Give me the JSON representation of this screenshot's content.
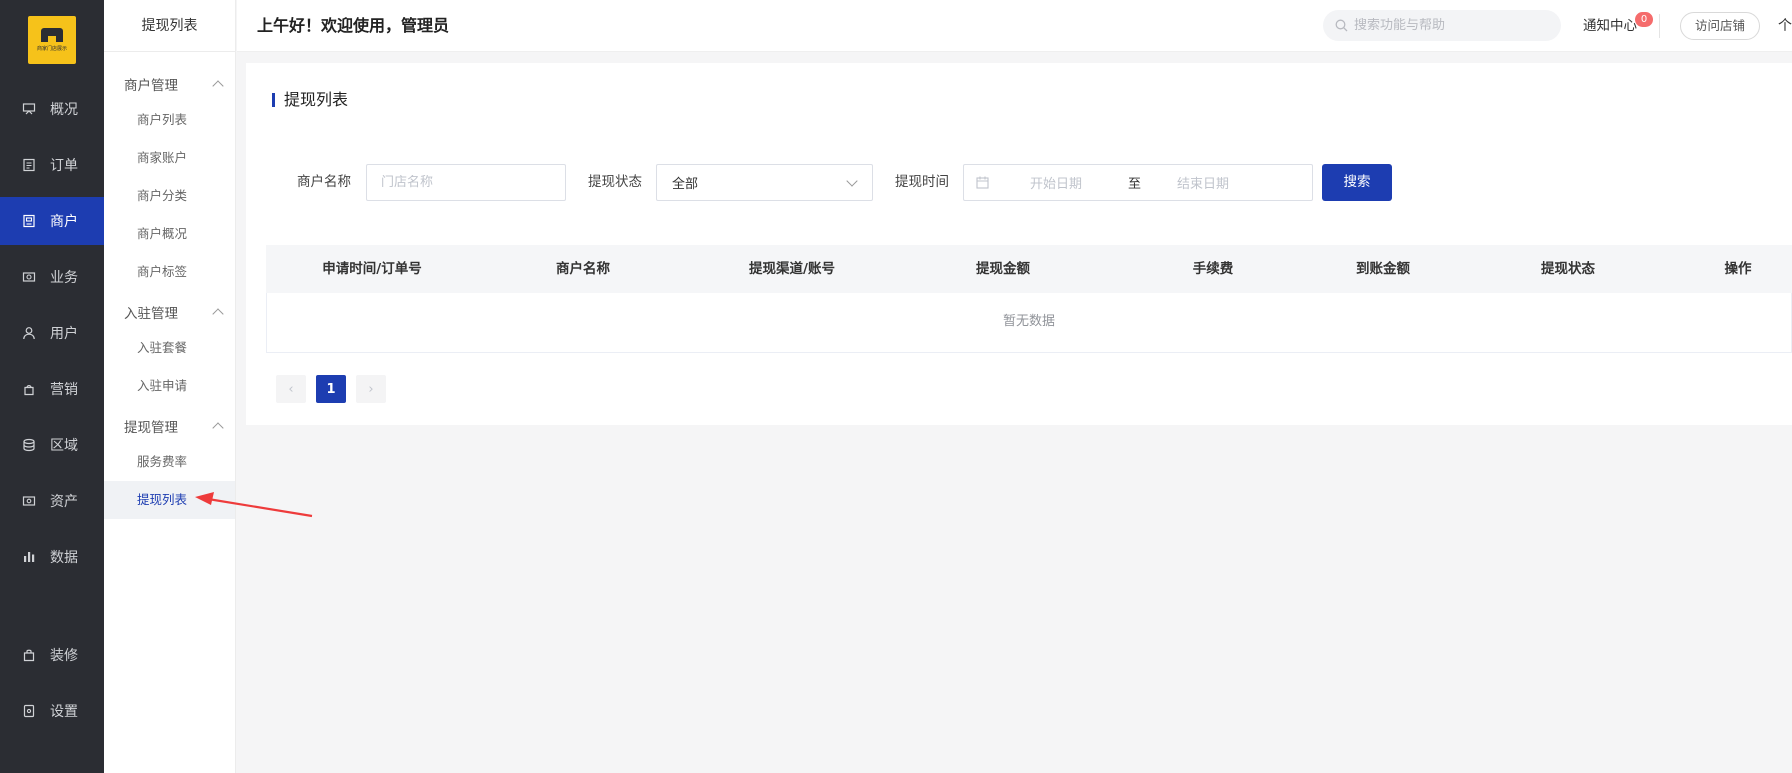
{
  "rail": {
    "logo_text": "商家门店展示",
    "items": [
      {
        "label": "概况",
        "icon": "dashboard-icon"
      },
      {
        "label": "订单",
        "icon": "order-icon"
      },
      {
        "label": "商户",
        "icon": "merchant-icon"
      },
      {
        "label": "业务",
        "icon": "business-icon"
      },
      {
        "label": "用户",
        "icon": "user-icon"
      },
      {
        "label": "营销",
        "icon": "marketing-icon"
      },
      {
        "label": "区域",
        "icon": "region-icon"
      },
      {
        "label": "资产",
        "icon": "asset-icon"
      },
      {
        "label": "数据",
        "icon": "chart-icon"
      },
      {
        "label": "装修",
        "icon": "decorate-icon"
      },
      {
        "label": "设置",
        "icon": "settings-icon"
      }
    ],
    "active_index": 2,
    "accent_color": "#1d3db1"
  },
  "submenu": {
    "title": "提现列表",
    "groups": [
      {
        "label": "商户管理",
        "items": [
          "商户列表",
          "商家账户",
          "商户分类",
          "商户概况",
          "商户标签"
        ]
      },
      {
        "label": "入驻管理",
        "items": [
          "入驻套餐",
          "入驻申请"
        ]
      },
      {
        "label": "提现管理",
        "items": [
          "服务费率",
          "提现列表"
        ]
      }
    ],
    "active_item": "提现列表"
  },
  "header": {
    "greeting": "上午好！欢迎使用，管理员",
    "search_placeholder": "搜索功能与帮助",
    "notice_label": "通知中心",
    "notice_count": "0",
    "visit_label": "访问店铺",
    "more_label": "个"
  },
  "main": {
    "title": "提现列表",
    "filters": {
      "merchant_label": "商户名称",
      "merchant_placeholder": "门店名称",
      "status_label": "提现状态",
      "status_value": "全部",
      "time_label": "提现时间",
      "start_placeholder": "开始日期",
      "range_sep": "至",
      "end_placeholder": "结束日期",
      "search_button": "搜索"
    },
    "table": {
      "columns": [
        "申请时间/订单号",
        "商户名称",
        "提现渠道/账号",
        "提现金额",
        "手续费",
        "到账金额",
        "提现状态",
        "操作"
      ],
      "empty_text": "暂无数据"
    },
    "pagination": {
      "prev": "‹",
      "current_page": "1",
      "next": "›"
    }
  }
}
